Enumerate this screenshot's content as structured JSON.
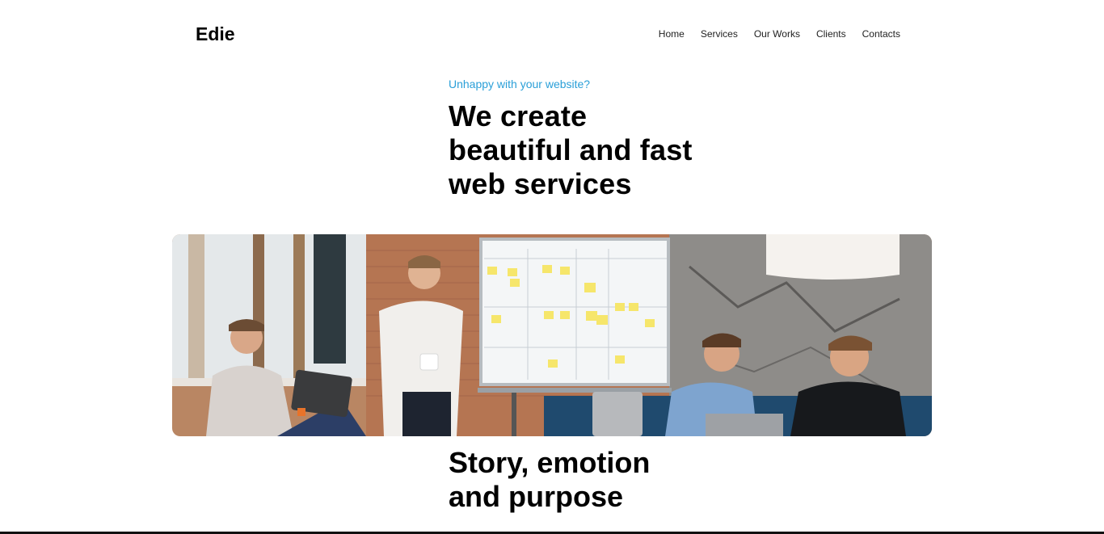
{
  "brand": {
    "name": "Edie"
  },
  "nav": {
    "items": [
      {
        "label": "Home"
      },
      {
        "label": "Services"
      },
      {
        "label": "Our Works"
      },
      {
        "label": "Clients"
      },
      {
        "label": "Contacts"
      }
    ]
  },
  "hero": {
    "eyebrow": "Unhappy with your website?",
    "headline_lines": [
      "We create",
      "beautiful and fast",
      "web services"
    ]
  },
  "section": {
    "title_lines": [
      "Story, emotion",
      "and purpose"
    ]
  },
  "colors": {
    "accent": "#2a9fd8",
    "text": "#000000",
    "background": "#ffffff"
  }
}
